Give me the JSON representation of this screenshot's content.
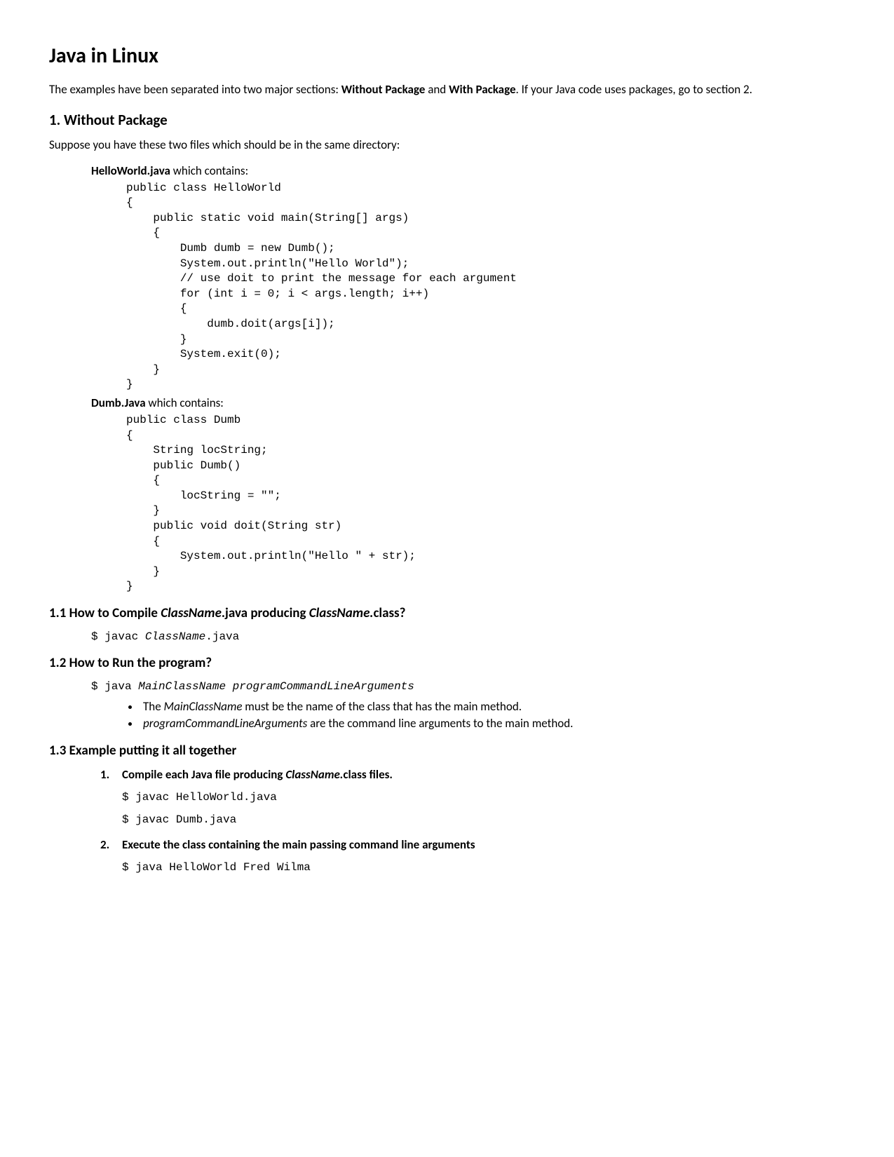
{
  "title": "Java in Linux",
  "intro": {
    "pre": "The examples have been separated into two major sections:  ",
    "bold1": "Without Package",
    "mid": " and ",
    "bold2": "With Package",
    "post": ".  If your Java code uses packages, go to section 2."
  },
  "s1": {
    "heading": "1. Without Package",
    "intro": "Suppose you have these two files which should be in the same directory:",
    "file1": {
      "name": "HelloWorld.java",
      "suffix": " which contains:"
    },
    "code1": "public class HelloWorld\n{\n    public static void main(String[] args)\n    {\n        Dumb dumb = new Dumb();\n        System.out.println(\"Hello World\");\n        // use doit to print the message for each argument\n        for (int i = 0; i < args.length; i++)\n        {\n            dumb.doit(args[i]);\n        }\n        System.exit(0);\n    }\n}",
    "file2": {
      "name": "Dumb.Java",
      "suffix": " which contains:"
    },
    "code2": "public class Dumb\n{\n    String locString;\n    public Dumb()\n    {\n        locString = \"\";\n    }\n    public void doit(String str)\n    {\n        System.out.println(\"Hello \" + str);\n    }\n}"
  },
  "s11": {
    "h_pre": "1.1 How to Compile ",
    "h_it1": "ClassName",
    "h_mid": ".java producing ",
    "h_it2": "ClassName.",
    "h_post": "class?",
    "cmd_pre": "$ javac ",
    "cmd_it": "ClassName",
    "cmd_post": ".java"
  },
  "s12": {
    "heading": "1.2 How to Run the program?",
    "cmd_pre": "$ java ",
    "cmd_it": "MainClassName programCommandLineArguments",
    "bullet1_pre": "The ",
    "bullet1_it": "MainClassName",
    "bullet1_post": " must be the name of the class that has the main method.",
    "bullet2_it": "programCommandLineArguments",
    "bullet2_post": " are the command line arguments to the main method."
  },
  "s13": {
    "heading": "1.3 Example putting it all together",
    "step1_pre": "Compile each Java file producing ",
    "step1_it": "ClassName.",
    "step1_post": "class files.",
    "step1_cmd1": "$ javac HelloWorld.java",
    "step1_cmd2": "$ javac Dumb.java",
    "step2": "Execute the class containing the main passing command line arguments",
    "step2_cmd": "$ java HelloWorld Fred Wilma"
  }
}
